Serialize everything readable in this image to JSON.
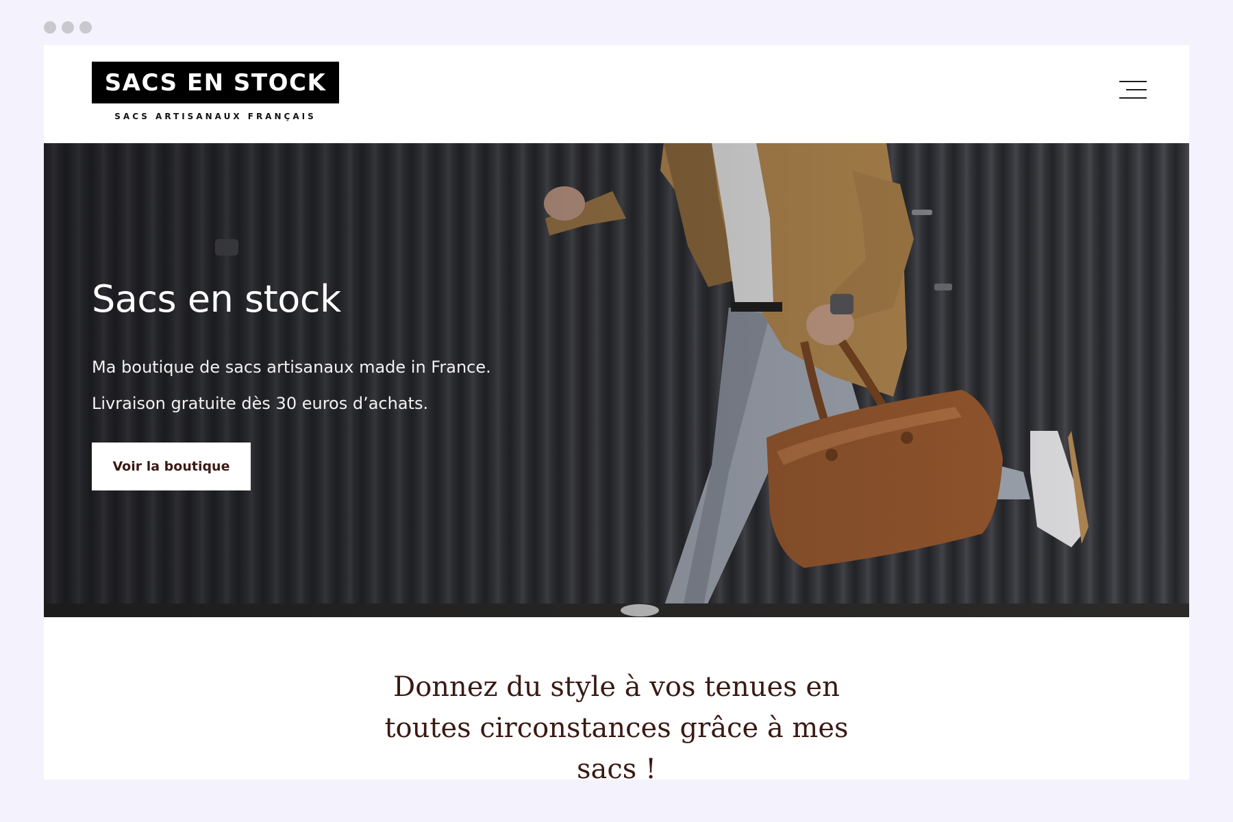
{
  "header": {
    "logo_title": "SACS EN STOCK",
    "logo_tagline": "SACS ARTISANAUX FRANÇAIS",
    "menu_icon": "hamburger-menu-icon"
  },
  "hero": {
    "title": "Sacs en stock",
    "line1": "Ma boutique de sacs artisanaux made in France.",
    "line2": "Livraison gratuite dès 30 euros d’achats.",
    "cta_label": "Voir la boutique"
  },
  "section": {
    "tagline": "Donnez du style à vos tenues en toutes circonstances grâce à mes sacs !"
  },
  "colors": {
    "page_background": "#f4f3fd",
    "accent_text": "#3a1a14",
    "logo_background": "#000000"
  }
}
